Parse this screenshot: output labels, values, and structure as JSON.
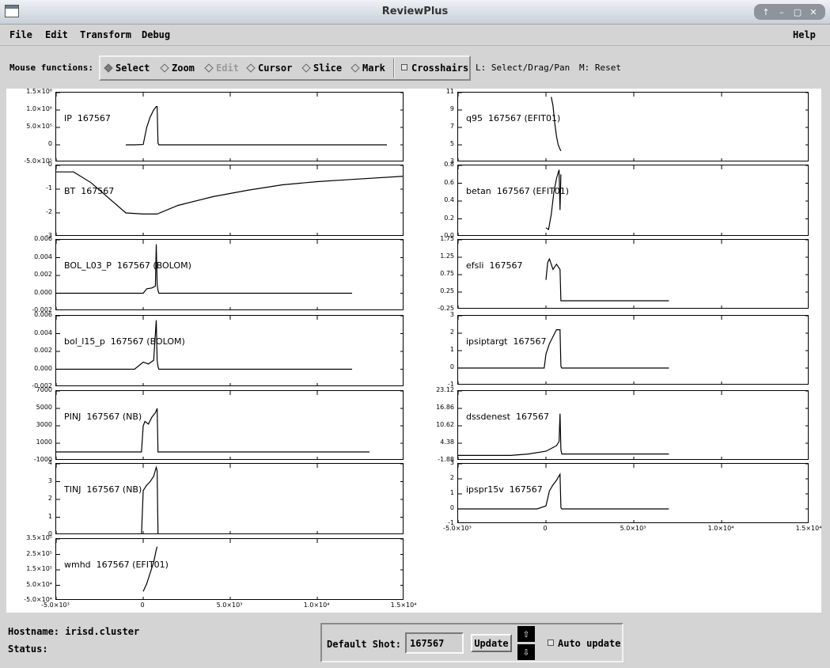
{
  "window": {
    "title": "ReviewPlus",
    "controls": [
      "↑",
      "–",
      "▢",
      "✕"
    ]
  },
  "menu": {
    "file": "File",
    "edit": "Edit",
    "transform": "Transform",
    "debug": "Debug",
    "help": "Help"
  },
  "toolbar": {
    "label": "Mouse functions:",
    "modes": [
      {
        "label": "Select",
        "selected": true,
        "enabled": true
      },
      {
        "label": "Zoom",
        "selected": false,
        "enabled": true
      },
      {
        "label": "Edit",
        "selected": false,
        "enabled": false
      },
      {
        "label": "Cursor",
        "selected": false,
        "enabled": true
      },
      {
        "label": "Slice",
        "selected": false,
        "enabled": true
      },
      {
        "label": "Mark",
        "selected": false,
        "enabled": true
      }
    ],
    "crosshairs": {
      "label": "Crosshairs",
      "checked": false
    },
    "hint_left": "L: Select/Drag/Pan",
    "hint_middle": "M: Reset"
  },
  "chart_data": [
    {
      "type": "line",
      "title": "IP  167567",
      "yticks": [
        "1.5×10⁶",
        "1.0×10⁶",
        "5.0×10⁵",
        "0",
        "-5.0×10⁵"
      ],
      "ylim": [
        -500000,
        1500000
      ],
      "xlim": [
        -5000,
        15000
      ],
      "x": [
        -1000,
        -500,
        0,
        200,
        400,
        600,
        750,
        800,
        850,
        900,
        5000,
        10000,
        14000
      ],
      "y": [
        0,
        0,
        10000,
        500000,
        800000,
        1000000,
        1100000,
        1100000,
        50000,
        0,
        0,
        0,
        0
      ]
    },
    {
      "type": "line",
      "title": "BT  167567",
      "yticks": [
        "0",
        "-1",
        "-2",
        "-3"
      ],
      "ylim": [
        -3,
        0.3
      ],
      "xlim": [
        -5000,
        15000
      ],
      "x": [
        -5000,
        -4000,
        -3000,
        -2000,
        -1000,
        0,
        800,
        2000,
        4000,
        6000,
        8000,
        10000,
        12000,
        15000
      ],
      "y": [
        0,
        0,
        -0.5,
        -1.2,
        -1.9,
        -1.95,
        -1.95,
        -1.55,
        -1.15,
        -0.85,
        -0.6,
        -0.45,
        -0.35,
        -0.2
      ]
    },
    {
      "type": "line",
      "title": "BOL_L03_P  167567 (BOLOM)",
      "yticks": [
        "0.006",
        "0.004",
        "0.002",
        "0.000",
        "-0.002"
      ],
      "ylim": [
        -0.002,
        0.006
      ],
      "xlim": [
        -5000,
        15000
      ],
      "x": [
        -5000,
        0,
        200,
        500,
        700,
        750,
        800,
        850,
        900,
        1500,
        5000,
        12000
      ],
      "y": [
        0,
        0,
        0.0005,
        0.0006,
        0.0008,
        0.0055,
        0.001,
        0.0003,
        0,
        0,
        0,
        0
      ]
    },
    {
      "type": "line",
      "title": "bol_l15_p  167567 (BOLOM)",
      "yticks": [
        "0.006",
        "0.004",
        "0.002",
        "0.000",
        "-0.002"
      ],
      "ylim": [
        -0.002,
        0.006
      ],
      "xlim": [
        -5000,
        15000
      ],
      "x": [
        -5000,
        -500,
        0,
        300,
        600,
        750,
        800,
        850,
        900,
        1500,
        5000,
        12000
      ],
      "y": [
        0,
        0,
        0.0008,
        0.0006,
        0.001,
        0.0055,
        0.001,
        0.0003,
        0,
        0,
        0,
        0
      ]
    },
    {
      "type": "line",
      "title": "PINJ  167567 (NB)",
      "yticks": [
        "7000",
        "5000",
        "3000",
        "1000",
        "-1000"
      ],
      "ylim": [
        -1000,
        7000
      ],
      "xlim": [
        -5000,
        15000
      ],
      "x": [
        -5000,
        -100,
        0,
        100,
        300,
        500,
        700,
        800,
        850,
        900,
        5000,
        13000
      ],
      "y": [
        0,
        0,
        3000,
        3500,
        3200,
        4000,
        4500,
        5000,
        0,
        0,
        0,
        0
      ]
    },
    {
      "type": "line",
      "title": "TINJ  167567 (NB)",
      "yticks": [
        "4",
        "3",
        "2",
        "1",
        "0"
      ],
      "ylim": [
        0,
        4
      ],
      "xlim": [
        -5000,
        15000
      ],
      "x": [
        -5000,
        -100,
        0,
        200,
        400,
        600,
        750,
        800,
        850,
        900,
        5000,
        13000
      ],
      "y": [
        0,
        0,
        2.5,
        2.8,
        3.0,
        3.3,
        3.8,
        3.6,
        0.1,
        0,
        0,
        0
      ]
    },
    {
      "type": "line",
      "title": "wmhd  167567 (EFIT01)",
      "yticks": [
        "3.5×10⁵",
        "2.5×10⁵",
        "1.5×10⁵",
        "5.0×10⁴",
        "-5.0×10⁴"
      ],
      "ylim": [
        -50000,
        350000
      ],
      "xlim": [
        -5000,
        15000
      ],
      "x": [
        0,
        200,
        400,
        600,
        750,
        800
      ],
      "y": [
        10000,
        60000,
        130000,
        200000,
        280000,
        300000
      ],
      "xticks": [
        "-5.0×10³",
        "0",
        "5.0×10³",
        "1.0×10⁴",
        "1.5×10⁴"
      ]
    },
    {
      "type": "line",
      "title": "q95  167567 (EFIT01)",
      "yticks": [
        "11",
        "9",
        "7",
        "5",
        "3"
      ],
      "ylim": [
        3,
        11
      ],
      "xlim": [
        -5000,
        15000
      ],
      "x": [
        300,
        400,
        500,
        600,
        700,
        800,
        850
      ],
      "y": [
        10.5,
        9.5,
        7.5,
        6,
        5,
        4.5,
        4.3
      ]
    },
    {
      "type": "line",
      "title": "betan  167567 (EFIT01)",
      "yticks": [
        "0.8",
        "0.6",
        "0.4",
        "0.2",
        "0.0"
      ],
      "ylim": [
        0,
        0.8
      ],
      "xlim": [
        -5000,
        15000
      ],
      "x": [
        0,
        150,
        300,
        450,
        600,
        700,
        750,
        800,
        850
      ],
      "y": [
        0.1,
        0.08,
        0.25,
        0.5,
        0.65,
        0.72,
        0.75,
        0.3,
        0.7
      ]
    },
    {
      "type": "line",
      "title": "efsli  167567",
      "yticks": [
        "1.75",
        "1.25",
        "0.75",
        "0.25",
        "-0.25"
      ],
      "ylim": [
        -0.25,
        1.75
      ],
      "xlim": [
        -5000,
        15000
      ],
      "x": [
        0,
        100,
        200,
        400,
        600,
        800,
        850,
        900,
        5000,
        7000
      ],
      "y": [
        0.6,
        1.1,
        1.2,
        0.9,
        1.05,
        0.9,
        0,
        0,
        0,
        0
      ]
    },
    {
      "type": "line",
      "title": "ipsiptargt  167567",
      "yticks": [
        "3",
        "2",
        "1",
        "0",
        "-1"
      ],
      "ylim": [
        -1,
        3
      ],
      "xlim": [
        -5000,
        15000
      ],
      "x": [
        -5000,
        -100,
        0,
        200,
        400,
        600,
        800,
        850,
        900,
        5000,
        7000
      ],
      "y": [
        0,
        0,
        0.8,
        1.4,
        1.8,
        2.2,
        2.2,
        0.1,
        0,
        0,
        0
      ]
    },
    {
      "type": "line",
      "title": "dssdenest  167567",
      "yticks": [
        "23.12",
        "16.86",
        "10.62",
        "4.38",
        "-1.88"
      ],
      "ylim": [
        -1.88,
        23.12
      ],
      "xlim": [
        -5000,
        15000
      ],
      "x": [
        -5000,
        -2000,
        -1000,
        0,
        300,
        600,
        750,
        800,
        850,
        900,
        5000,
        7000
      ],
      "y": [
        0,
        0,
        0.5,
        1.5,
        2.5,
        3.5,
        5,
        15,
        2,
        0.5,
        0.5,
        0.5
      ]
    },
    {
      "type": "line",
      "title": "ipspr15v  167567",
      "yticks": [
        "3",
        "2",
        "1",
        "0",
        "-1"
      ],
      "ylim": [
        -1,
        3
      ],
      "xlim": [
        -5000,
        15000
      ],
      "x": [
        -5000,
        -1000,
        -500,
        0,
        200,
        400,
        600,
        750,
        800,
        850,
        900,
        5000,
        7000
      ],
      "y": [
        0,
        0,
        0,
        0.2,
        1.2,
        1.6,
        1.9,
        2.2,
        2.3,
        0.1,
        0,
        0,
        0
      ],
      "xticks": [
        "-5.0×10³",
        "0",
        "5.0×10³",
        "1.0×10⁴",
        "1.5×10⁴"
      ]
    }
  ],
  "footer": {
    "hostname": "Hostname: irisd.cluster",
    "status": "Status:",
    "default_shot_label": "Default Shot:",
    "default_shot_value": "167567",
    "update_label": "Update",
    "auto_update_label": "Auto update",
    "auto_update_checked": false
  }
}
